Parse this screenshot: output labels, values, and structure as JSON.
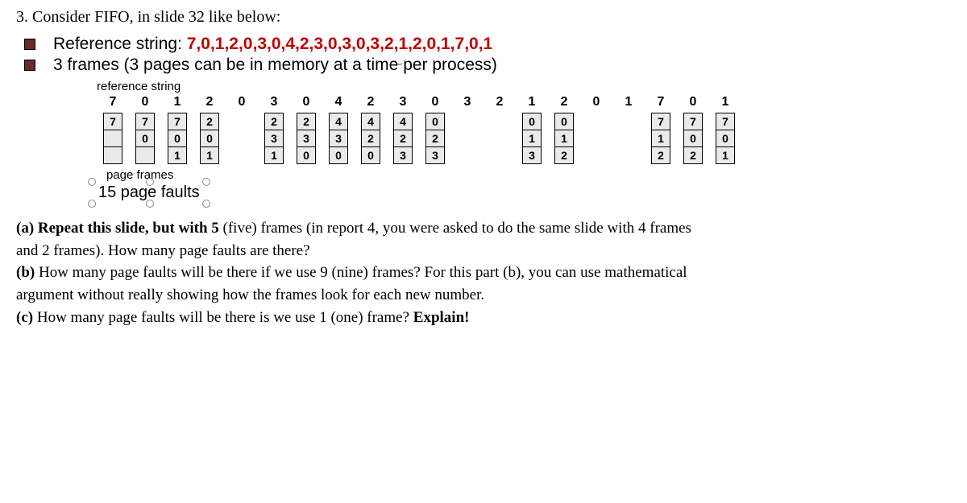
{
  "question": {
    "number": "3.",
    "prompt": "Consider FIFO, in slide 32 like below:"
  },
  "bullets": {
    "line1_prefix": "Reference string: ",
    "line1_value": "7,0,1,2,0,3,0,4,2,3,0,3,0,3,2,1,2,0,1,7,0,1",
    "line2": "3 frames (3 pages can be in memory at a time per process)"
  },
  "slide": {
    "ref_label": "reference string",
    "refs": [
      "7",
      "0",
      "1",
      "2",
      "0",
      "3",
      "0",
      "4",
      "2",
      "3",
      "0",
      "3",
      "2",
      "1",
      "2",
      "0",
      "1",
      "7",
      "0",
      "1"
    ],
    "columns": [
      {
        "show": true,
        "cells": [
          "7",
          "",
          ""
        ],
        "eye": false
      },
      {
        "show": true,
        "cells": [
          "7",
          "0",
          ""
        ],
        "eye": true
      },
      {
        "show": true,
        "cells": [
          "7",
          "0",
          "1"
        ],
        "eye": false
      },
      {
        "show": true,
        "cells": [
          "2",
          "0",
          "1"
        ],
        "eye": false
      },
      {
        "show": false,
        "cells": [],
        "eye": false
      },
      {
        "show": true,
        "cells": [
          "2",
          "3",
          "1"
        ],
        "eye": false
      },
      {
        "show": true,
        "cells": [
          "2",
          "3",
          "0"
        ],
        "eye": false
      },
      {
        "show": true,
        "cells": [
          "4",
          "3",
          "0"
        ],
        "eye": false
      },
      {
        "show": true,
        "cells": [
          "4",
          "2",
          "0"
        ],
        "eye": false
      },
      {
        "show": true,
        "cells": [
          "4",
          "2",
          "3"
        ],
        "eye": false
      },
      {
        "show": true,
        "cells": [
          "0",
          "2",
          "3"
        ],
        "eye": false
      },
      {
        "show": false,
        "cells": [],
        "eye": false
      },
      {
        "show": false,
        "cells": [],
        "eye": false
      },
      {
        "show": true,
        "cells": [
          "0",
          "1",
          "3"
        ],
        "eye": false
      },
      {
        "show": true,
        "cells": [
          "0",
          "1",
          "2"
        ],
        "eye": false
      },
      {
        "show": false,
        "cells": [],
        "eye": false
      },
      {
        "show": false,
        "cells": [],
        "eye": false
      },
      {
        "show": true,
        "cells": [
          "7",
          "1",
          "2"
        ],
        "eye": false
      },
      {
        "show": true,
        "cells": [
          "7",
          "0",
          "2"
        ],
        "eye": false
      },
      {
        "show": true,
        "cells": [
          "7",
          "0",
          "1"
        ],
        "eye": false
      }
    ],
    "pf_label": "page frames",
    "faults": "15 page faults"
  },
  "parts": {
    "a_label": "(a)",
    "a_bold": "Repeat this slide, but with 5",
    "a_rest1": " (five) frames (in report 4, you were asked to do the same slide with 4 frames",
    "a_rest2": "and 2 frames).  How many page faults are there?",
    "b_label": "(b)",
    "b_text1": " How many page faults will be there if we use 9 (nine) frames? For this part (b), you can use mathematical",
    "b_text2": "argument without really showing how the frames look for each new number.",
    "c_label": "(c)",
    "c_text": " How many page faults will be there is we use 1 (one) frame? ",
    "c_bold": "Explain!"
  }
}
